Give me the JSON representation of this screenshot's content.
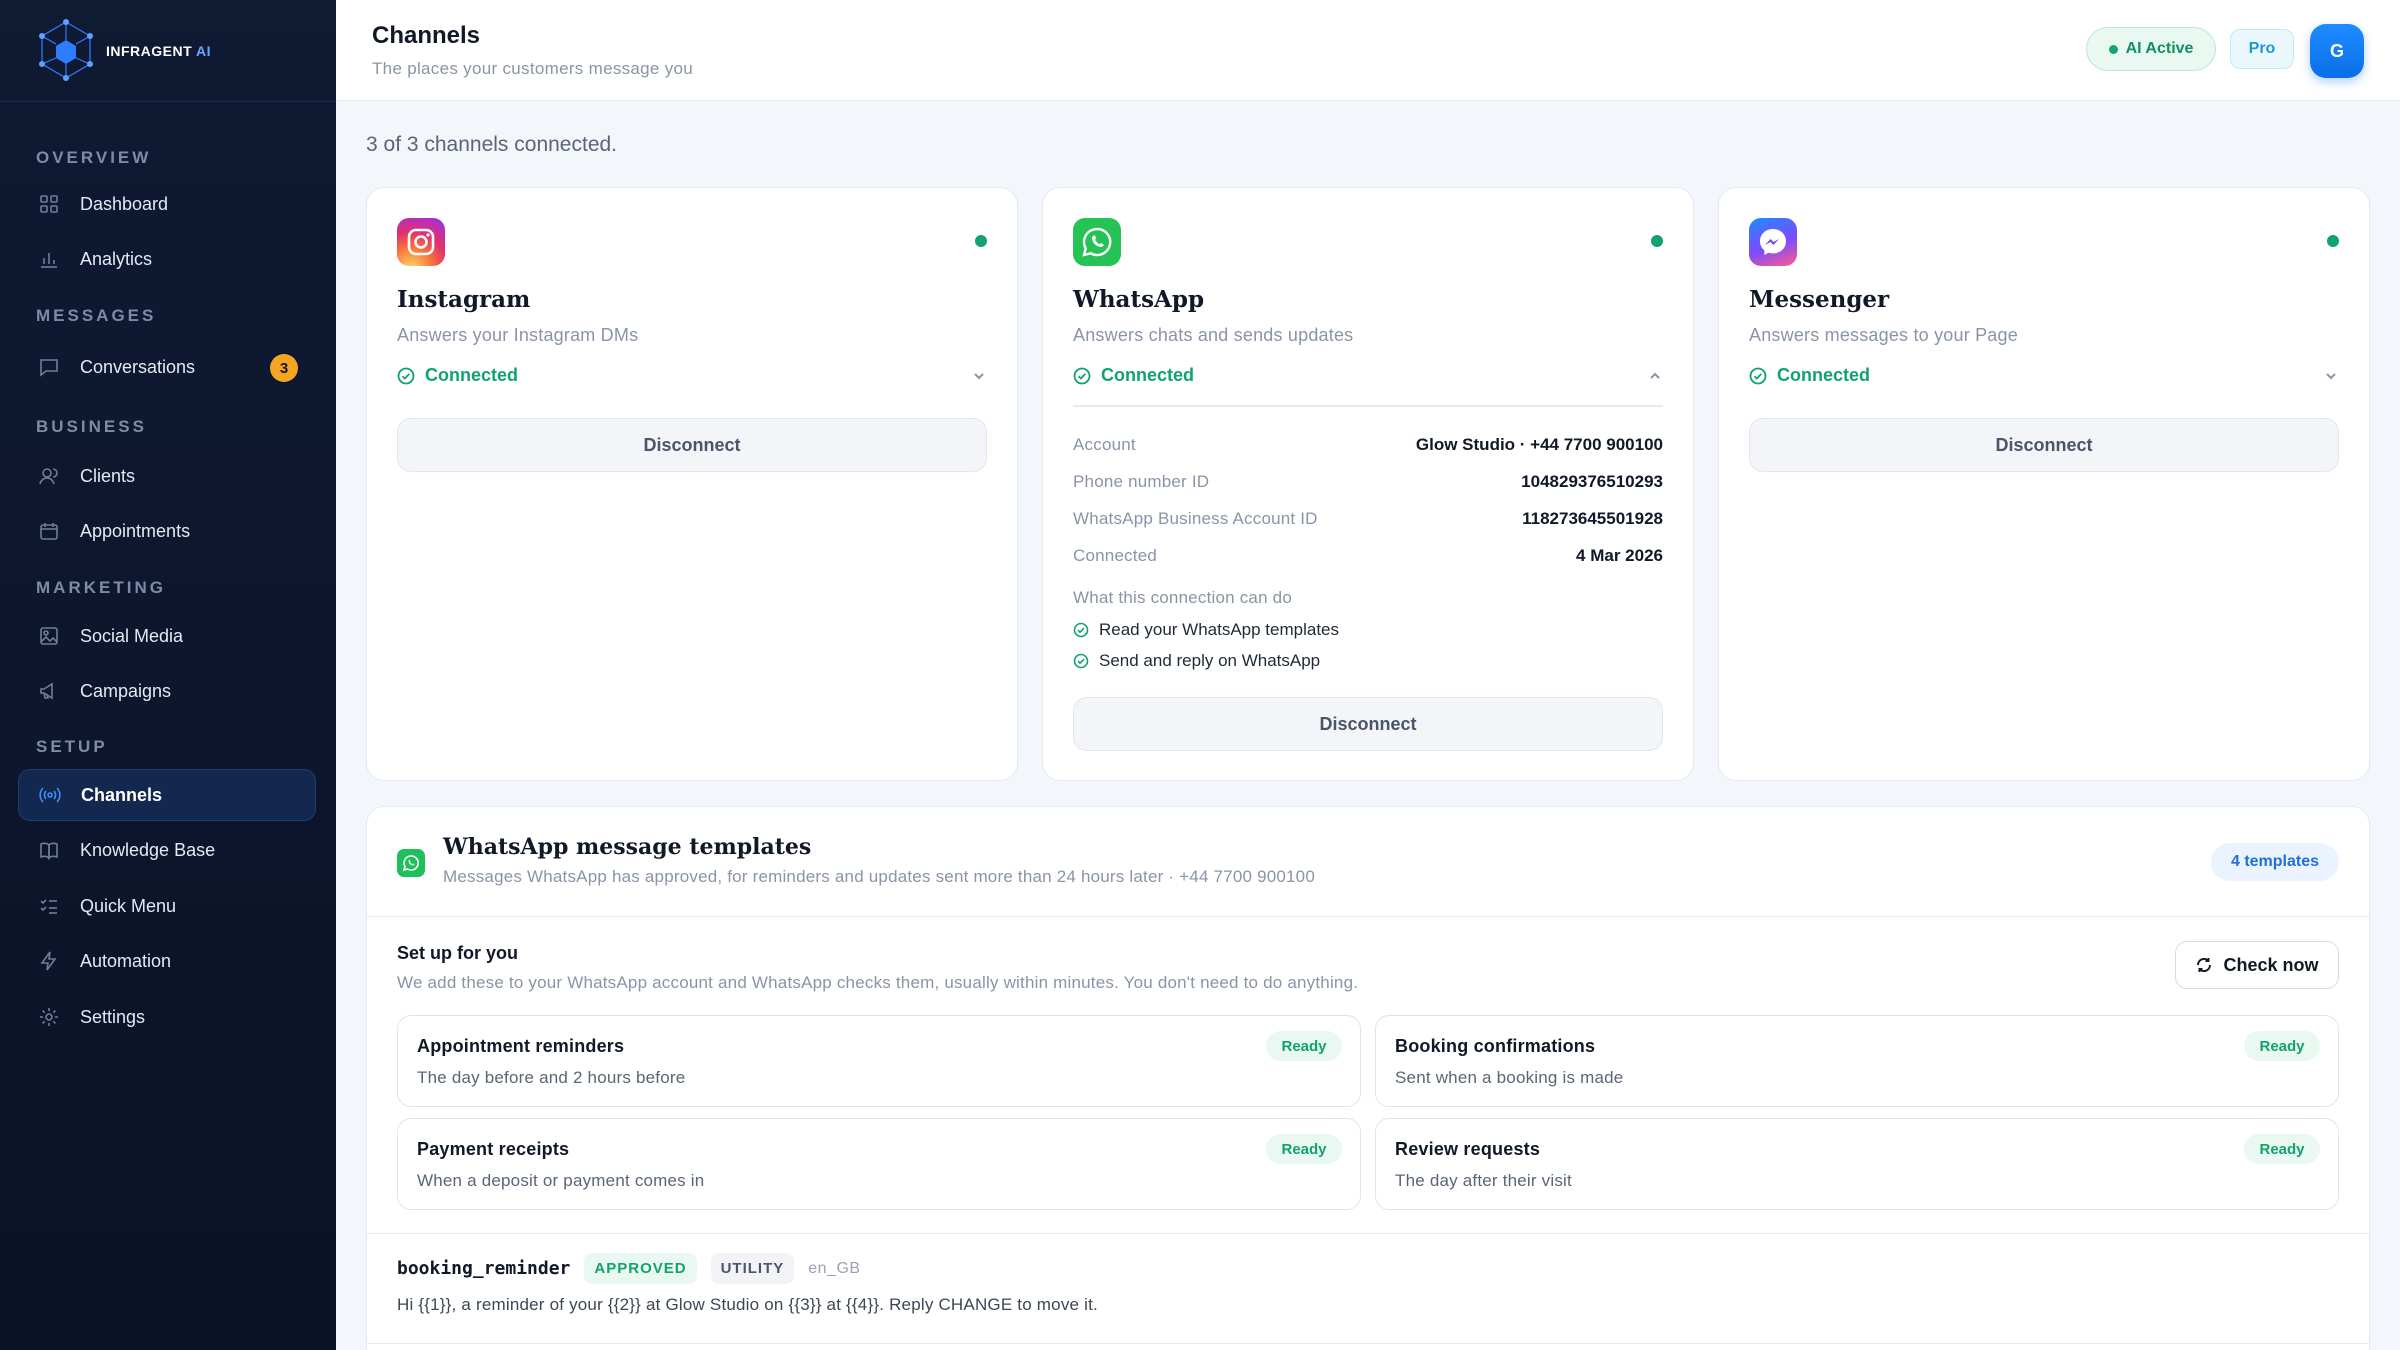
{
  "brand": {
    "name": "INFRAGENT",
    "suffix": "AI"
  },
  "sidebar": {
    "sections": [
      {
        "label": "OVERVIEW"
      },
      {
        "label": "MESSAGES"
      },
      {
        "label": "BUSINESS"
      },
      {
        "label": "MARKETING"
      },
      {
        "label": "SETUP"
      }
    ],
    "items": [
      {
        "label": "Dashboard",
        "icon": "grid-icon"
      },
      {
        "label": "Analytics",
        "icon": "bar-chart-icon"
      },
      {
        "label": "Conversations",
        "icon": "chat-icon",
        "badge": "3"
      },
      {
        "label": "Clients",
        "icon": "users-icon"
      },
      {
        "label": "Appointments",
        "icon": "calendar-icon"
      },
      {
        "label": "Social Media",
        "icon": "image-icon"
      },
      {
        "label": "Campaigns",
        "icon": "megaphone-icon"
      },
      {
        "label": "Channels",
        "icon": "broadcast-icon",
        "active": true
      },
      {
        "label": "Knowledge Base",
        "icon": "book-icon"
      },
      {
        "label": "Quick Menu",
        "icon": "list-check-icon"
      },
      {
        "label": "Automation",
        "icon": "bolt-icon"
      },
      {
        "label": "Settings",
        "icon": "gear-icon"
      }
    ]
  },
  "header": {
    "title": "Channels",
    "subtitle": "The places your customers message you",
    "ai_status": "AI Active",
    "plan": "Pro",
    "avatar_initial": "G"
  },
  "summary": "3 of 3 channels connected.",
  "channels": [
    {
      "name": "Instagram",
      "desc": "Answers your Instagram DMs",
      "status": "Connected",
      "action": "Disconnect",
      "expanded": false
    },
    {
      "name": "WhatsApp",
      "desc": "Answers chats and sends updates",
      "status": "Connected",
      "action": "Disconnect",
      "expanded": true,
      "details": [
        {
          "k": "Account",
          "v": "Glow Studio · +44 7700 900100"
        },
        {
          "k": "Phone number ID",
          "v": "104829376510293"
        },
        {
          "k": "WhatsApp Business Account ID",
          "v": "118273645501928"
        },
        {
          "k": "Connected",
          "v": "4 Mar 2026"
        }
      ],
      "capabilities_title": "What this connection can do",
      "capabilities": [
        "Read your WhatsApp templates",
        "Send and reply on WhatsApp"
      ]
    },
    {
      "name": "Messenger",
      "desc": "Answers messages to your Page",
      "status": "Connected",
      "action": "Disconnect",
      "expanded": false
    }
  ],
  "templates": {
    "title": "WhatsApp message templates",
    "subtitle": "Messages WhatsApp has approved, for reminders and updates sent more than 24 hours later · +44 7700 900100",
    "count": "4 templates",
    "setup_title": "Set up for you",
    "setup_sub": "We add these to your WhatsApp account and WhatsApp checks them, usually within minutes. You don't need to do anything.",
    "check_label": "Check now",
    "cards": [
      {
        "title": "Appointment reminders",
        "desc": "The day before and 2 hours before",
        "status": "Ready"
      },
      {
        "title": "Booking confirmations",
        "desc": "Sent when a booking is made",
        "status": "Ready"
      },
      {
        "title": "Payment receipts",
        "desc": "When a deposit or payment comes in",
        "status": "Ready"
      },
      {
        "title": "Review requests",
        "desc": "The day after their visit",
        "status": "Ready"
      }
    ],
    "approved": {
      "name": "booking_reminder",
      "status": "APPROVED",
      "category": "UTILITY",
      "lang": "en_GB",
      "body": "Hi {{1}}, a reminder of your {{2}} at Glow Studio on {{3}} at {{4}}. Reply CHANGE to move it."
    }
  },
  "colors": {
    "accent": "#1e8cff",
    "success": "#11a36e",
    "sidebar_bg": "#0f1a33",
    "badge": "#f5a524"
  }
}
